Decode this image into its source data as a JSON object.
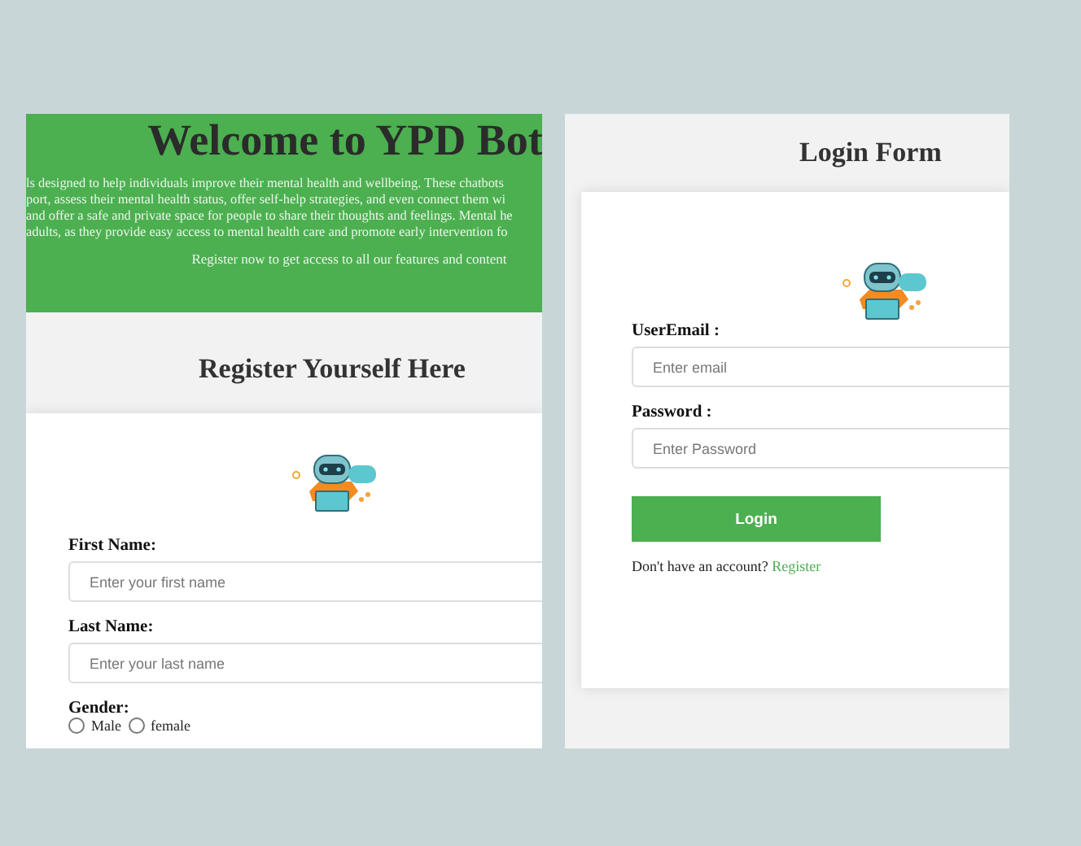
{
  "register_page": {
    "banner": {
      "title": "Welcome to YPD Bot",
      "intro_lines": [
        "ls designed to help individuals improve their mental health and wellbeing. These chatbots",
        "port, assess their mental health status, offer self-help strategies, and even connect them wi",
        "and offer a safe and private space for people to share their thoughts and feelings. Mental he",
        "adults, as they provide easy access to mental health care and promote early intervention fo"
      ],
      "cta": "Register now to get access to all our features and content"
    },
    "heading": "Register Yourself Here",
    "fields": [
      {
        "label": "First Name:",
        "placeholder": "Enter your first name"
      },
      {
        "label": "Last Name:",
        "placeholder": "Enter your last name"
      }
    ],
    "gender": {
      "label": "Gender:",
      "options": [
        {
          "label": "Male",
          "selected": false
        },
        {
          "label": "female",
          "selected": false
        }
      ]
    }
  },
  "login_page": {
    "heading": "Login Form",
    "fields": [
      {
        "label": "UserEmail :",
        "placeholder": "Enter email"
      },
      {
        "label": "Password :",
        "placeholder": "Enter Password"
      }
    ],
    "button": "Login",
    "footer": {
      "text": "Don't have an account?",
      "link": "Register"
    }
  }
}
